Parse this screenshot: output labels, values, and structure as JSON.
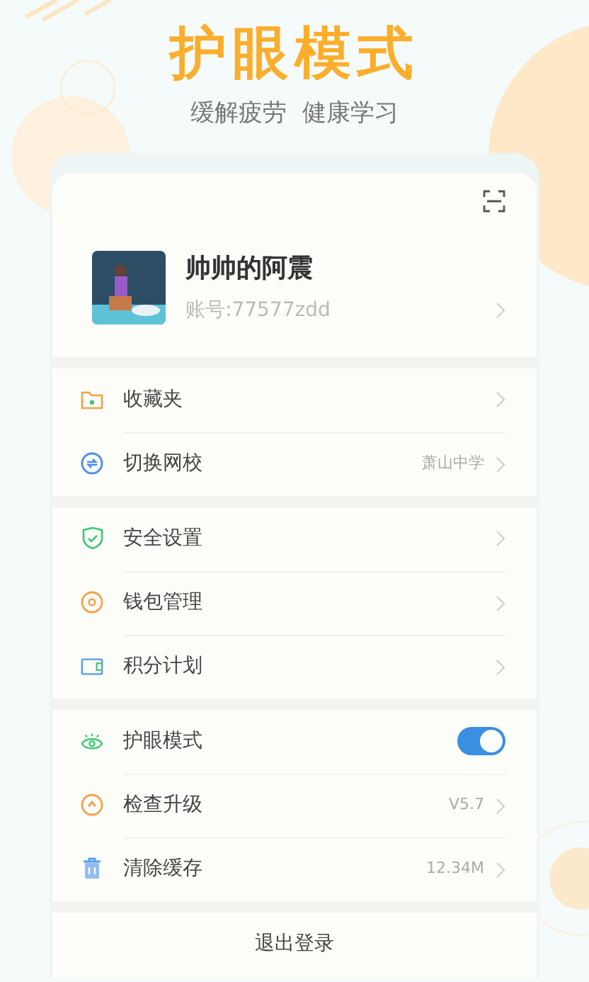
{
  "header": {
    "title": "护眼模式",
    "subtitle": "缓解疲劳  健康学习"
  },
  "profile": {
    "name": "帅帅的阿震",
    "account": "账号:77577zdd"
  },
  "sections": [
    {
      "items": [
        {
          "kind": "link",
          "label": "收藏夹"
        },
        {
          "kind": "link",
          "label": "切换网校",
          "value": "萧山中学"
        }
      ]
    },
    {
      "items": [
        {
          "kind": "link",
          "label": "安全设置"
        },
        {
          "kind": "link",
          "label": "钱包管理"
        },
        {
          "kind": "link",
          "label": "积分计划"
        }
      ]
    },
    {
      "items": [
        {
          "kind": "toggle",
          "label": "护眼模式",
          "on": true
        },
        {
          "kind": "link",
          "label": "检查升级",
          "value": "V5.7"
        },
        {
          "kind": "link",
          "label": "清除缓存",
          "value": "12.34M"
        }
      ]
    }
  ],
  "logout": "退出登录"
}
